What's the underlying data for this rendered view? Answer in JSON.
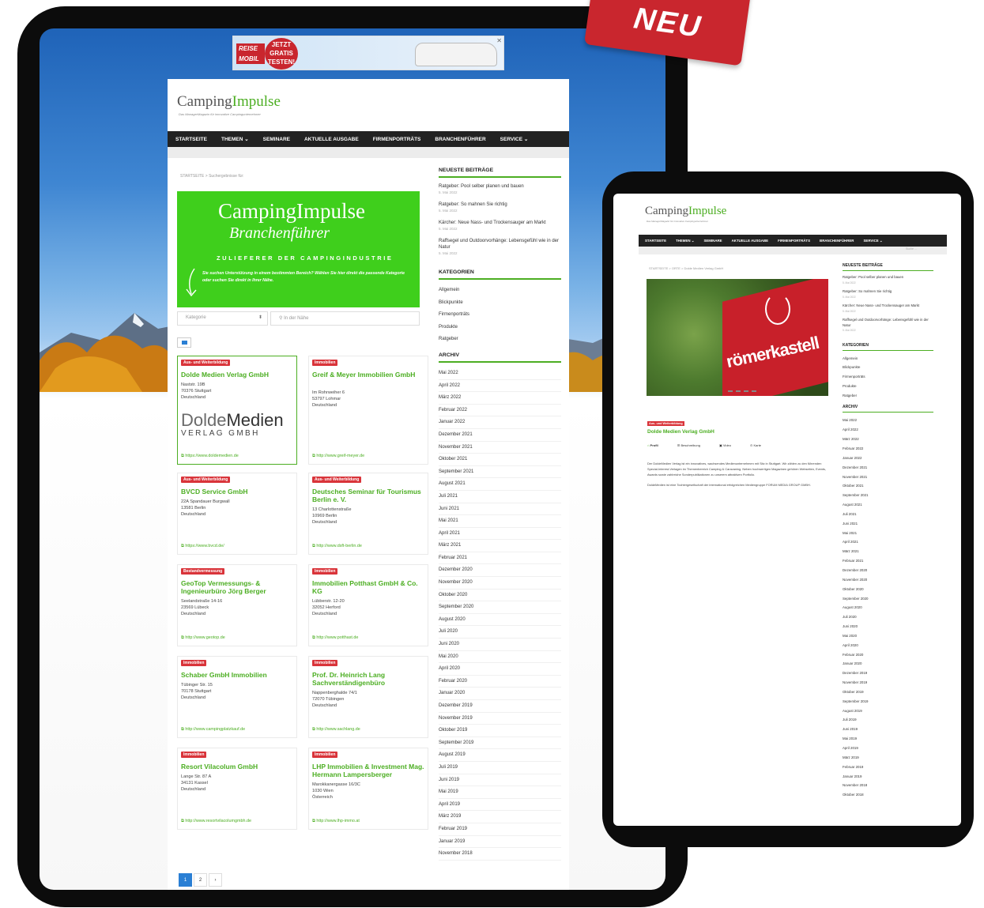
{
  "badge": "NEU",
  "ad": {
    "logo_line1": "REISE",
    "logo_line2": "MOBIL",
    "burst": "JETZT GRATIS TESTEN!",
    "close": "✕"
  },
  "site": {
    "logo_camping": "Camping",
    "logo_impulse": "Impulse",
    "logo_sub": "Das ManagerMagazin für innovative Campingunternehmer",
    "nav": [
      "STARTSEITE",
      "THEMEN ⌄",
      "SEMINARE",
      "AKTUELLE AUSGABE",
      "FIRMENPORTRÄTS",
      "BRANCHENFÜHRER",
      "SERVICE ⌄"
    ]
  },
  "main": {
    "breadcrumb": "STARTSEITE  >  Suchergebnisse für:",
    "hero": {
      "line1": "CampingImpulse",
      "line2": "Branchenführer",
      "line3": "ZULIEFERER DER CAMPINGINDUSTRIE",
      "line4": "Sie suchen Unterstützung in einem bestimmten Bereich? Wählen Sie hier direkt die passende Kategorie oder suchen Sie direkt in Ihrer Nähe."
    },
    "filter": {
      "category": "Kategorie",
      "location": "In der Nähe"
    },
    "cards": [
      {
        "tag": "Aus- und Weiterbildung",
        "name": "Dolde Medien Verlag GmbH",
        "address": [
          "Naststr. 19B",
          "70376 Stuttgart",
          "Deutschland"
        ],
        "url": "https://www.doldemedien.de",
        "logo_a": "Dolde",
        "logo_b": "Medien",
        "logo_c": "VERLAG GMBH"
      },
      {
        "tag": "Immobilien",
        "name": "Greif & Meyer Immobilien GmbH",
        "address": [
          "Im Rohrweiher 6",
          "53797 Lohmar",
          "Deutschland"
        ],
        "url": "http://www.greif-meyer.de"
      },
      {
        "tag": "Aus- und Weiterbildung",
        "name": "BVCD Service GmbH",
        "address": [
          "22A Spandauer Burgwall",
          "13581 Berlin",
          "Deutschland"
        ],
        "url": "https://www.bvcd.de/"
      },
      {
        "tag": "Aus- und Weiterbildung",
        "name": "Deutsches Seminar für Tourismus Berlin e. V.",
        "address": [
          "13 Charlottenstraße",
          "10969 Berlin",
          "Deutschland"
        ],
        "url": "http://www.dsft-berlin.de"
      },
      {
        "tag": "Bestandvermessung",
        "name": "GeoTop Vermessungs- & Ingenieurbüro Jörg Berger",
        "address": [
          "Seelandstraße 14-16",
          "23569 Lübeck",
          "Deutschland"
        ],
        "url": "http://www.geotop.de"
      },
      {
        "tag": "Immobilien",
        "name": "Immobilien Potthast GmbH & Co. KG",
        "address": [
          "Lübberstr. 12-20",
          "32052 Herford",
          "Deutschland"
        ],
        "url": "http://www.potthast.de"
      },
      {
        "tag": "Immobilien",
        "name": "Schaber GmbH Immobilien",
        "address": [
          "Tübinger Str. 15",
          "70178 Stuttgart",
          "Deutschland"
        ],
        "url": "http://www.campingplatzkauf.de"
      },
      {
        "tag": "Immobilien",
        "name": "Prof. Dr. Heinrich Lang Sachverständigenbüro",
        "address": [
          "Nappenberghalde 74/1",
          "72070 Tübingen",
          "Deutschland"
        ],
        "url": "http://www.sachlang.de"
      },
      {
        "tag": "Immobilien",
        "name": "Resort Vilacolum GmbH",
        "address": [
          "Lange Str. 87 A",
          "34131 Kassel",
          "Deutschland"
        ],
        "url": "http://www.resortvilacolumgmbh.de"
      },
      {
        "tag": "Immobilien",
        "name": "LHP Immobilien & Investment Mag. Hermann Lampersberger",
        "address": [
          "Marokkanergasse 16/3C",
          "1030 Wien",
          "Österreich"
        ],
        "url": "http://www.lhp-immo.at"
      }
    ],
    "pagination": [
      "1",
      "2",
      "›"
    ]
  },
  "sidebar": {
    "latest_title": "NEUESTE BEITRÄGE",
    "posts": [
      {
        "title": "Ratgeber: Pool selber planen und bauen",
        "date": "5. Mai 2022"
      },
      {
        "title": "Ratgeber: So mahnen Sie richtig",
        "date": "5. Mai 2022"
      },
      {
        "title": "Kärcher: Neue Nass- und Trockensauger am Markt",
        "date": "5. Mai 2022"
      },
      {
        "title": "Raffsegel und Outdoorvorhänge: Lebensgefühl wie in der Natur",
        "date": "5. Mai 2022"
      }
    ],
    "categories_title": "KATEGORIEN",
    "categories": [
      "Allgemein",
      "Blickpunkte",
      "Firmenporträts",
      "Produkte",
      "Ratgeber"
    ],
    "archive_title": "ARCHIV",
    "archive": [
      "Mai 2022",
      "April 2022",
      "März 2022",
      "Februar 2022",
      "Januar 2022",
      "Dezember 2021",
      "November 2021",
      "Oktober 2021",
      "September 2021",
      "August 2021",
      "Juli 2021",
      "Juni 2021",
      "Mai 2021",
      "April 2021",
      "März 2021",
      "Februar 2021",
      "Dezember 2020",
      "November 2020",
      "Oktober 2020",
      "September 2020",
      "August 2020",
      "Juli 2020",
      "Juni 2020",
      "Mai 2020",
      "April 2020",
      "Februar 2020",
      "Januar 2020",
      "Dezember 2019",
      "November 2019",
      "Oktober 2019",
      "September 2019",
      "August 2019",
      "Juli 2019",
      "Juni 2019",
      "Mai 2019",
      "April 2019",
      "März 2019",
      "Februar 2019",
      "Januar 2019",
      "November 2018"
    ]
  },
  "detail": {
    "breadcrumb": "STARTSEITE  >  ORTE  >  Dolde Medien Verlag GmbH",
    "photo_sign": "römerkastell",
    "tag": "Aus- und Weiterbildung",
    "title": "Dolde Medien Verlag GmbH",
    "tabs": [
      "Profil",
      "Beschreibung",
      "Video",
      "Karte"
    ],
    "search": "Suche …",
    "desc1": "Der DoldeMedien Verlag ist ein innovatives, wachsendes Medienunternehmen mit Sitz in Stuttgart. Wir zählen zu den führenden Special-Interest-Verlagen im Themenbereich Camping & Caravaning. Neben hochwertigen Magazinen gehören Webseiten, Events, Awards sowie zahlreiche Sonderpublikationen zu unserem attraktiven Portfolio.",
    "desc2": "DoldeMedien ist eine Tochtergesellschaft der international erfolgreichen Mediengruppe FORUM MEDIA GROUP GMBH.",
    "archive": [
      "Mai 2022",
      "April 2022",
      "März 2022",
      "Februar 2022",
      "Januar 2022",
      "Dezember 2021",
      "November 2021",
      "Oktober 2021",
      "September 2021",
      "August 2021",
      "Juli 2021",
      "Juni 2021",
      "Mai 2021",
      "April 2021",
      "März 2021",
      "Februar 2021",
      "Dezember 2020",
      "November 2020",
      "Oktober 2020",
      "September 2020",
      "August 2020",
      "Juli 2020",
      "Juni 2020",
      "Mai 2020",
      "April 2020",
      "Februar 2020",
      "Januar 2020",
      "Dezember 2019",
      "November 2019",
      "Oktober 2019",
      "September 2019",
      "August 2019",
      "Juli 2019",
      "Juni 2019",
      "Mai 2019",
      "April 2019",
      "März 2019",
      "Februar 2019",
      "Januar 2019",
      "November 2018",
      "Oktober 2018"
    ]
  }
}
